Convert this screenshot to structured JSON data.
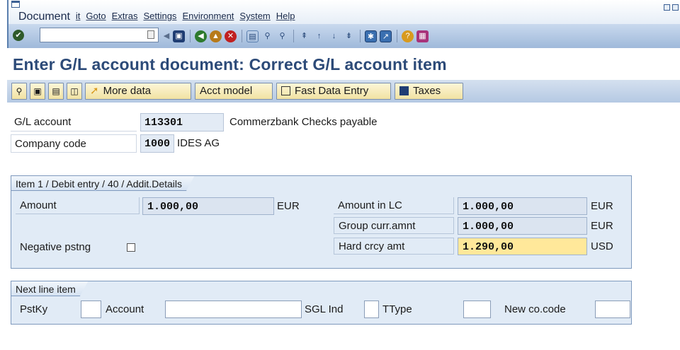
{
  "menubar": {
    "items": [
      "Document",
      "it",
      "Goto",
      "Extras",
      "Settings",
      "Environment",
      "System",
      "Help"
    ]
  },
  "toolbar": {
    "command_value": "",
    "icons": [
      "enter-icon",
      "back-icon",
      "exit-icon",
      "cancel-icon",
      "print-icon",
      "find-icon",
      "find-next-icon",
      "first-page-icon",
      "previous-page-icon",
      "next-page-icon",
      "last-page-icon",
      "create-session-icon",
      "shortcut-icon",
      "help-icon",
      "layout-icon"
    ]
  },
  "page": {
    "title": "Enter G/L account document: Correct G/L account item"
  },
  "app_toolbar": {
    "icon_buttons": [
      "display-icon",
      "park-icon",
      "save-icon",
      "copy-icon",
      "arrow-icon"
    ],
    "more_data": "More data",
    "acct_model": "Acct model",
    "fast_data_entry": "Fast Data Entry",
    "taxes": "Taxes"
  },
  "header": {
    "gl_account_label": "G/L account",
    "gl_account_value": "113301",
    "gl_account_desc": "Commerzbank Checks payable",
    "company_code_label": "Company code",
    "company_code_value": "1000",
    "company_code_desc": "IDES AG"
  },
  "item_group": {
    "title": "Item 1 / Debit entry / 40 / Addit.Details",
    "amount_label": "Amount",
    "amount_value": "1.000,00",
    "amount_currency": "EUR",
    "negative_label": "Negative pstng",
    "negative_checked": false,
    "amount_lc_label": "Amount in LC",
    "amount_lc_value": "1.000,00",
    "amount_lc_currency": "EUR",
    "group_curr_label": "Group curr.amnt",
    "group_curr_value": "1.000,00",
    "group_curr_currency": "EUR",
    "hard_crcy_label": "Hard crcy amt",
    "hard_crcy_value": "1.290,00",
    "hard_crcy_currency": "USD"
  },
  "next_line": {
    "title": "Next line item",
    "pstky_label": "PstKy",
    "account_label": "Account",
    "sgl_label": "SGL Ind",
    "ttype_label": "TType",
    "new_cocode_label": "New co.code"
  },
  "colors": {
    "title": "#2c4a78",
    "group_bg": "#e1ebf6",
    "highlight": "#ffe89a",
    "button": "#f1e2a2"
  }
}
